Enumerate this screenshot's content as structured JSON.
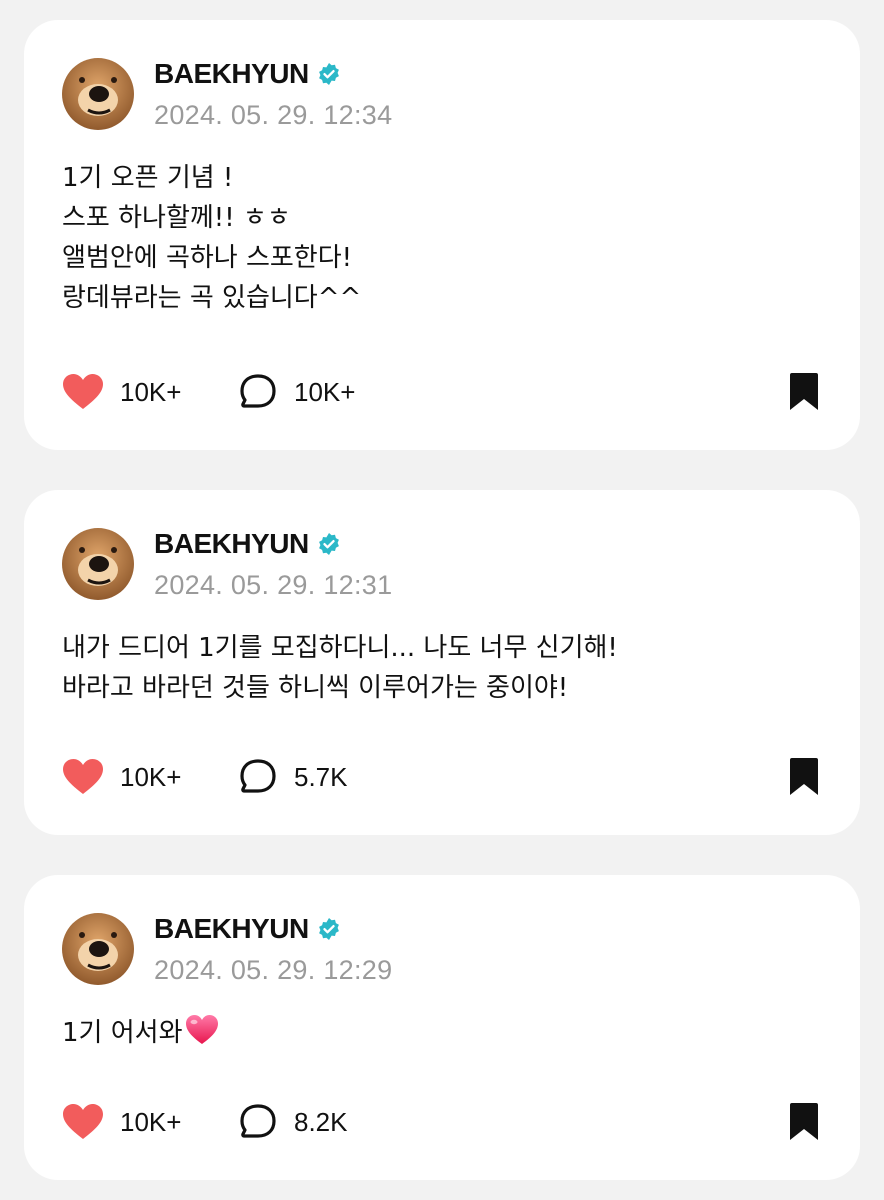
{
  "posts": [
    {
      "author": "BAEKHYUN",
      "verified": true,
      "timestamp": "2024. 05. 29. 12:34",
      "lines": [
        "1기 오픈 기념 !",
        "스포 하나할께!! ㅎㅎ",
        "앨범안에 곡하나 스포한다!",
        "랑데뷰라는 곡 있습니다^^"
      ],
      "likes": "10K+",
      "comments": "10K+"
    },
    {
      "author": "BAEKHYUN",
      "verified": true,
      "timestamp": "2024. 05. 29. 12:31",
      "lines": [
        "내가 드디어 1기를 모집하다니... 나도 너무 신기해!",
        "바라고 바라던 것들 하니씩 이루어가는 중이야!"
      ],
      "likes": "10K+",
      "comments": "5.7K"
    },
    {
      "author": "BAEKHYUN",
      "verified": true,
      "timestamp": "2024. 05. 29. 12:29",
      "lines": [
        "1기 어서와"
      ],
      "emoji": "heart-emoji",
      "likes": "10K+",
      "comments": "8.2K"
    }
  ],
  "icons": {
    "like": "heart-icon",
    "comment": "speech-bubble-icon",
    "bookmark": "bookmark-icon",
    "verified": "verified-badge-icon"
  },
  "colors": {
    "background": "#f2f2f2",
    "card": "#ffffff",
    "heart": "#f25c5c",
    "verified": "#2bb8c8",
    "timestamp": "#9a9a9a"
  }
}
